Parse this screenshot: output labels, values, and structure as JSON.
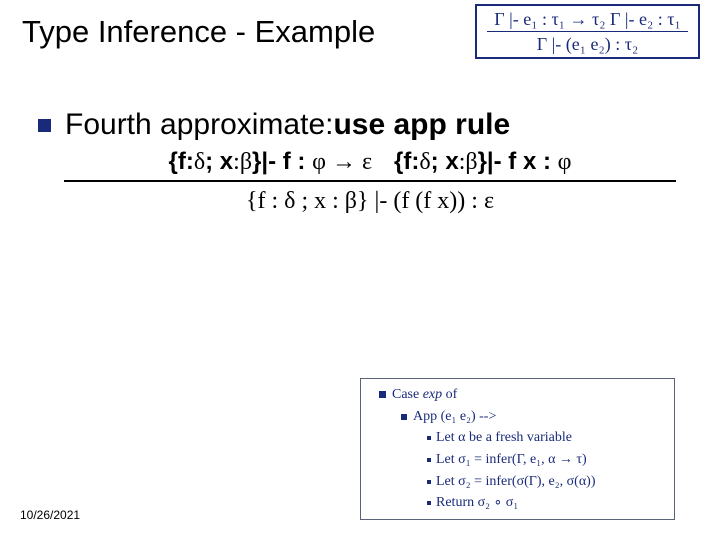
{
  "title": "Type Inference - Example",
  "rule": {
    "top": "Γ |- e₁ : τ₁ → τ₂    Γ |- e₂ : τ₁",
    "bot": "Γ |- (e₁ e₂) : τ₂"
  },
  "body": {
    "lead": "Fourth approximate: ",
    "bold": "use app rule"
  },
  "deriv": {
    "top_left_brace": "{f:",
    "top_d": "δ",
    "top_semi_x": "; x",
    "top_colon": ":",
    "top_b": "β",
    "top_close_turn": "}|- f : ",
    "top_phi": "φ",
    "top_arrow": " → ",
    "top_eps": "ε",
    "top_right_brace": "{f:",
    "top_d2": "δ",
    "top_semi_x2": "; x",
    "top_colon2": ":",
    "top_b2": "β",
    "top_close_turn2": "}|- f x : ",
    "top_phi2": "φ",
    "bot": "{f : δ ; x : β} |- (f (f x)) : ε"
  },
  "algo": {
    "l1a": "Case ",
    "l1b": "exp",
    "l1c": " of",
    "l2": "App (e₁ e₂) -->",
    "l3": "Let α be a fresh variable",
    "l4": "Let σ₁ = infer(Γ, e₁, α → τ)",
    "l5": "Let σ₂ = infer(σ(Γ), e₂, σ(α))",
    "l6": "Return σ₂ ∘ σ₁"
  },
  "date": "10/26/2021"
}
